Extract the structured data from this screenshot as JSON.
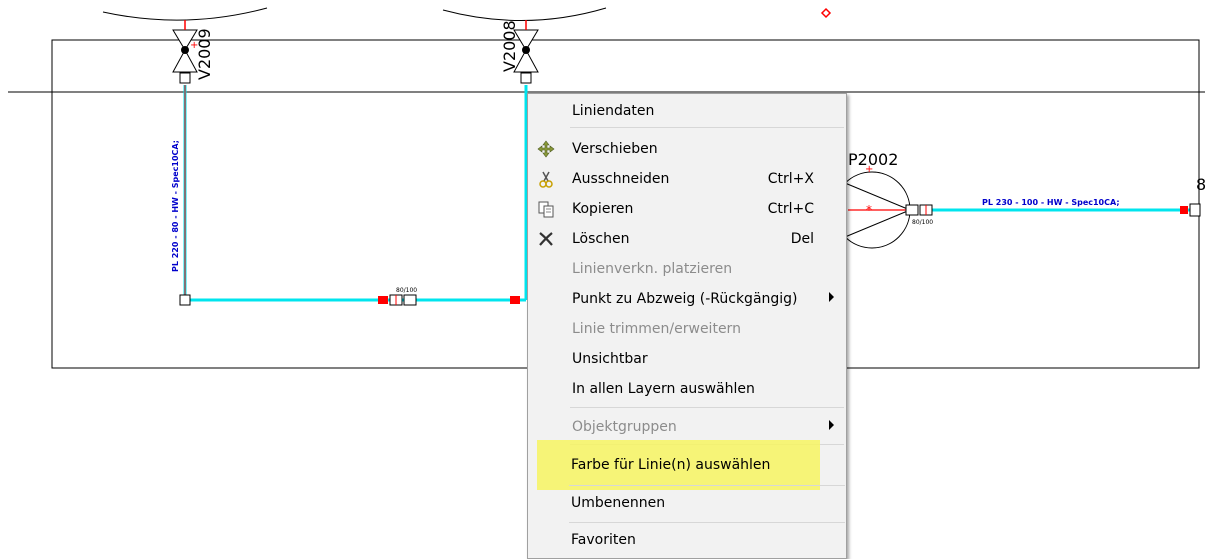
{
  "drawing": {
    "labels": {
      "valve_left": "V2009",
      "valve_mid": "V2008",
      "pump": "P2002",
      "pipe_vertical": "PL 220 - 80 - HW - Spec10CA;",
      "pipe_right": "PL 230 - 100 - HW - Spec10CA;",
      "reducer_bottom": "80/100",
      "reducer_right": "80/100",
      "edge_partial": "8"
    },
    "colors": {
      "pipe": "#00e5ee",
      "marker": "#ff0000",
      "pipe_text": "#0000cc",
      "frame": "#000000"
    }
  },
  "context_menu": {
    "items": [
      {
        "label": "Liniendaten",
        "icon": "",
        "shortcut": "",
        "disabled": false,
        "submenu": false
      },
      {
        "label": "Verschieben",
        "icon": "move-icon",
        "shortcut": "",
        "disabled": false,
        "submenu": false
      },
      {
        "label": "Ausschneiden",
        "icon": "scissors-icon",
        "shortcut": "Ctrl+X",
        "disabled": false,
        "submenu": false
      },
      {
        "label": "Kopieren",
        "icon": "copy-icon",
        "shortcut": "Ctrl+C",
        "disabled": false,
        "submenu": false
      },
      {
        "label": "Löschen",
        "icon": "delete-icon",
        "shortcut": "Del",
        "disabled": false,
        "submenu": false
      },
      {
        "label": "Linienverkn. platzieren",
        "icon": "",
        "shortcut": "",
        "disabled": true,
        "submenu": false
      },
      {
        "label": "Punkt zu Abzweig (-Rückgängig)",
        "icon": "",
        "shortcut": "",
        "disabled": false,
        "submenu": true
      },
      {
        "label": "Linie trimmen/erweitern",
        "icon": "",
        "shortcut": "",
        "disabled": true,
        "submenu": false
      },
      {
        "label": "Unsichtbar",
        "icon": "",
        "shortcut": "",
        "disabled": false,
        "submenu": false
      },
      {
        "label": "In allen Layern auswählen",
        "icon": "",
        "shortcut": "",
        "disabled": false,
        "submenu": false
      },
      {
        "label": "Objektgruppen",
        "icon": "",
        "shortcut": "",
        "disabled": true,
        "submenu": true
      },
      {
        "label": "Farbe für Linie(n) auswählen",
        "icon": "",
        "shortcut": "",
        "disabled": false,
        "submenu": false,
        "highlighted": true
      },
      {
        "label": "Umbenennen",
        "icon": "",
        "shortcut": "",
        "disabled": false,
        "submenu": false
      },
      {
        "label": "Favoriten",
        "icon": "",
        "shortcut": "",
        "disabled": false,
        "submenu": false
      }
    ],
    "highlight_color": "#f7f561"
  }
}
